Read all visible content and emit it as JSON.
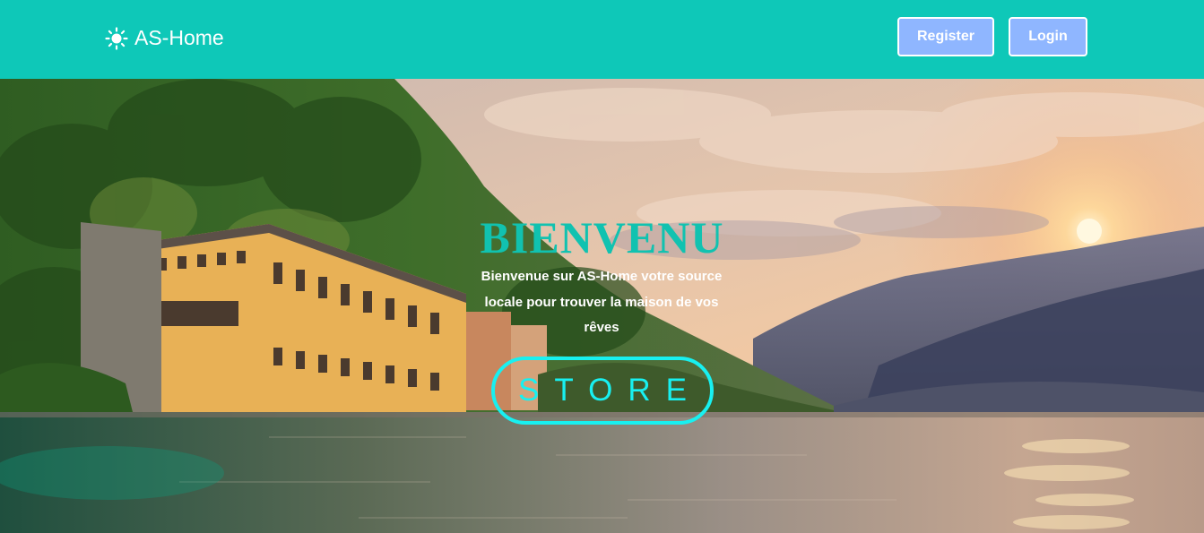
{
  "navbar": {
    "brand_label": "AS-Home",
    "brand_icon": "sun-icon",
    "register_label": "Register",
    "login_label": "Login",
    "background_color": "#0ec8b8",
    "button_color": "#8fb6ff"
  },
  "hero": {
    "title": "BIENVENU",
    "subtitle": "Bienvenue sur AS-Home votre source locale pour trouver la maison de vos rêves",
    "store_label": "STORE",
    "title_color": "#11c2b0",
    "store_color": "#18f0f0"
  }
}
